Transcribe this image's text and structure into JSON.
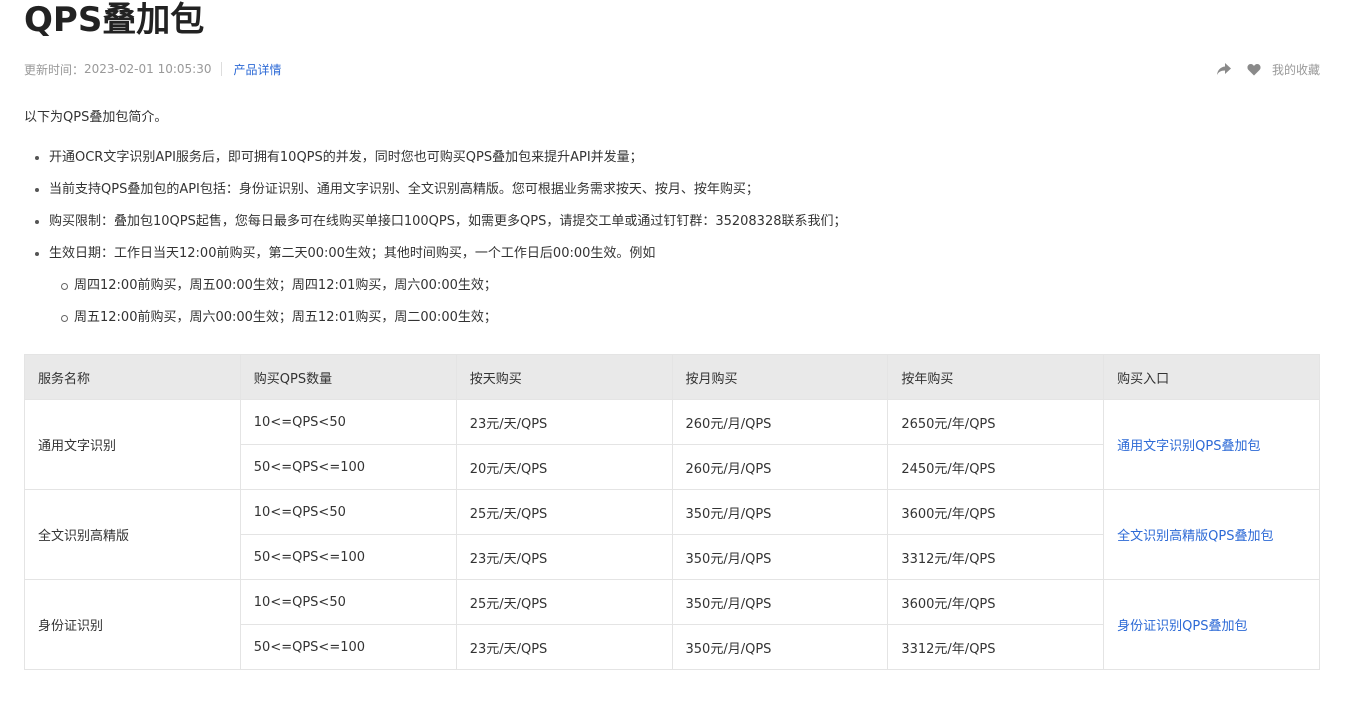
{
  "page": {
    "title": "QPS叠加包",
    "updated_label": "更新时间：",
    "updated_time": "2023-02-01 10:05:30",
    "product_link": "产品详情",
    "favorite_label": "我的收藏"
  },
  "intro": "以下为QPS叠加包简介。",
  "bullets": [
    "开通OCR文字识别API服务后，即可拥有10QPS的并发，同时您也可购买QPS叠加包来提升API并发量；",
    "当前支持QPS叠加包的API包括：身份证识别、通用文字识别、全文识别高精版。您可根据业务需求按天、按月、按年购买；",
    "购买限制：叠加包10QPS起售，您每日最多可在线购买单接口100QPS，如需更多QPS，请提交工单或通过钉钉群：35208328联系我们；",
    "生效日期：工作日当天12:00前购买，第二天00:00生效；其他时间购买，一个工作日后00:00生效。例如"
  ],
  "sub_bullets": [
    "周四12:00前购买，周五00:00生效；周四12:01购买，周六00:00生效；",
    "周五12:00前购买，周六00:00生效；周五12:01购买，周二00:00生效；"
  ],
  "table": {
    "headers": [
      "服务名称",
      "购买QPS数量",
      "按天购买",
      "按月购买",
      "按年购买",
      "购买入口"
    ],
    "groups": [
      {
        "name": "通用文字识别",
        "link": "通用文字识别QPS叠加包",
        "rows": [
          [
            "10<=QPS<50",
            "23元/天/QPS",
            "260元/月/QPS",
            "2650元/年/QPS"
          ],
          [
            "50<=QPS<=100",
            "20元/天/QPS",
            "260元/月/QPS",
            "2450元/年/QPS"
          ]
        ]
      },
      {
        "name": "全文识别高精版",
        "link": "全文识别高精版QPS叠加包",
        "rows": [
          [
            "10<=QPS<50",
            "25元/天/QPS",
            "350元/月/QPS",
            "3600元/年/QPS"
          ],
          [
            "50<=QPS<=100",
            "23元/天/QPS",
            "350元/月/QPS",
            "3312元/年/QPS"
          ]
        ]
      },
      {
        "name": "身份证识别",
        "link": "身份证识别QPS叠加包",
        "rows": [
          [
            "10<=QPS<50",
            "25元/天/QPS",
            "350元/月/QPS",
            "3600元/年/QPS"
          ],
          [
            "50<=QPS<=100",
            "23元/天/QPS",
            "350元/月/QPS",
            "3312元/年/QPS"
          ]
        ]
      }
    ]
  },
  "icons": {
    "share": "share-icon",
    "favorite": "heart-icon"
  },
  "colors": {
    "link": "#2d6ad6",
    "header_bg": "#e9e9e9"
  }
}
